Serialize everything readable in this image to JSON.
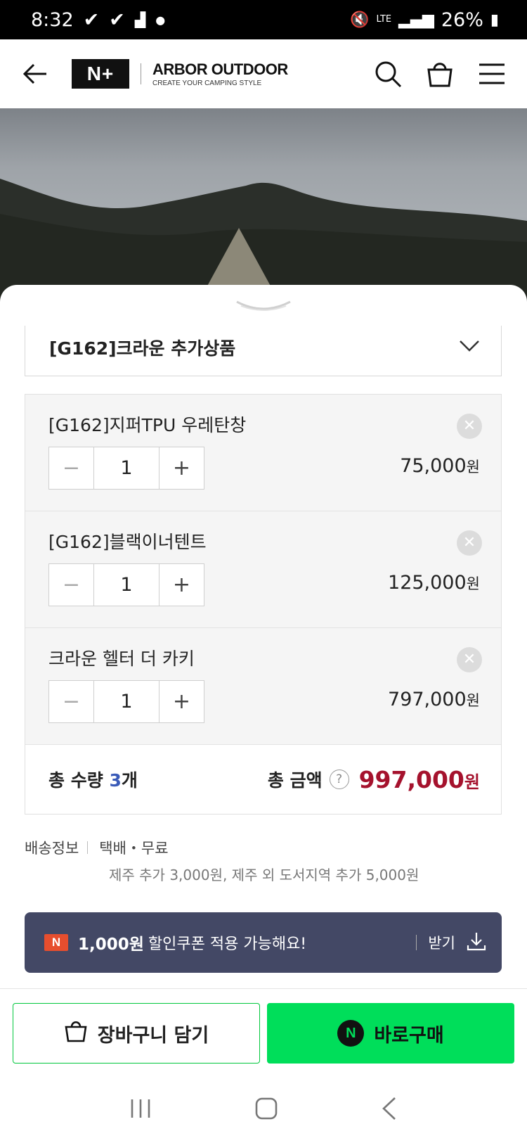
{
  "status_bar": {
    "time": "8:32",
    "battery": "26%",
    "network": "LTE"
  },
  "header": {
    "logo": "N+",
    "brand_name": "ARBOR OUTDOOR",
    "brand_slogan": "CREATE YOUR CAMPING STYLE"
  },
  "option_select": {
    "label": "[G162]크라운 추가상품"
  },
  "options": [
    {
      "name": "[G162]지퍼TPU 우레탄창",
      "qty": "1",
      "price": "75,000",
      "currency": "원"
    },
    {
      "name": "[G162]블랙이너텐트",
      "qty": "1",
      "price": "125,000",
      "currency": "원"
    },
    {
      "name": "크라운 헬터 더 카키",
      "qty": "1",
      "price": "797,000",
      "currency": "원"
    }
  ],
  "summary": {
    "qty_label": "총 수량",
    "qty_value": "3",
    "qty_unit": "개",
    "amount_label": "총 금액",
    "help": "?",
    "amount_value": "997,000",
    "currency": "원"
  },
  "delivery": {
    "label": "배송정보",
    "method": "택배・무료",
    "note": "제주 추가 3,000원, 제주 외 도서지역 추가 5,000원"
  },
  "coupon": {
    "badge": "N",
    "amount": "1,000원",
    "text": "할인쿠폰 적용 가능해요!",
    "action": "받기"
  },
  "actions": {
    "cart_label": "장바구니 담기",
    "buy_label": "바로구매",
    "buy_badge": "N"
  },
  "colors": {
    "accent_green": "#00de5a",
    "price_red": "#a5122d",
    "coupon_bg": "#434865",
    "qty_blue": "#3a5bb8"
  }
}
